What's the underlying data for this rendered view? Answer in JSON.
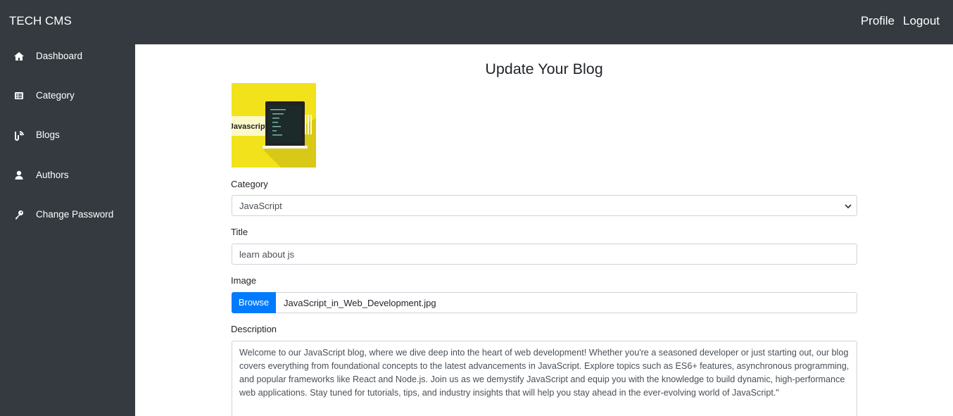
{
  "header": {
    "brand": "TECH CMS",
    "profile_label": "Profile",
    "logout_label": "Logout"
  },
  "sidebar": {
    "items": [
      {
        "label": "Dashboard",
        "icon": "home-icon"
      },
      {
        "label": "Category",
        "icon": "list-icon"
      },
      {
        "label": "Blogs",
        "icon": "blog-icon"
      },
      {
        "label": "Authors",
        "icon": "user-icon"
      },
      {
        "label": "Change Password",
        "icon": "key-icon"
      }
    ]
  },
  "form": {
    "title": "Update Your Blog",
    "image_preview_text": "Javascript",
    "category": {
      "label": "Category",
      "value": "JavaScript"
    },
    "title_field": {
      "label": "Title",
      "value": "learn about js"
    },
    "image": {
      "label": "Image",
      "browse_label": "Browse",
      "file_name": "JavaScript_in_Web_Development.jpg"
    },
    "description": {
      "label": "Description",
      "value": "Welcome to our JavaScript blog, where we dive deep into the heart of web development! Whether you're a seasoned developer or just starting out, our blog covers everything from foundational concepts to the latest advancements in JavaScript. Explore topics such as ES6+ features, asynchronous programming, and popular frameworks like React and Node.js. Join us as we demystify JavaScript and equip you with the knowledge to build dynamic, high-performance web applications. Stay tuned for tutorials, tips, and industry insights that will help you stay ahead in the ever-evolving world of JavaScript.\""
    }
  },
  "colors": {
    "nav_bg": "#343a40",
    "accent": "#007bff",
    "thumb_bg": "#f2e21b"
  }
}
